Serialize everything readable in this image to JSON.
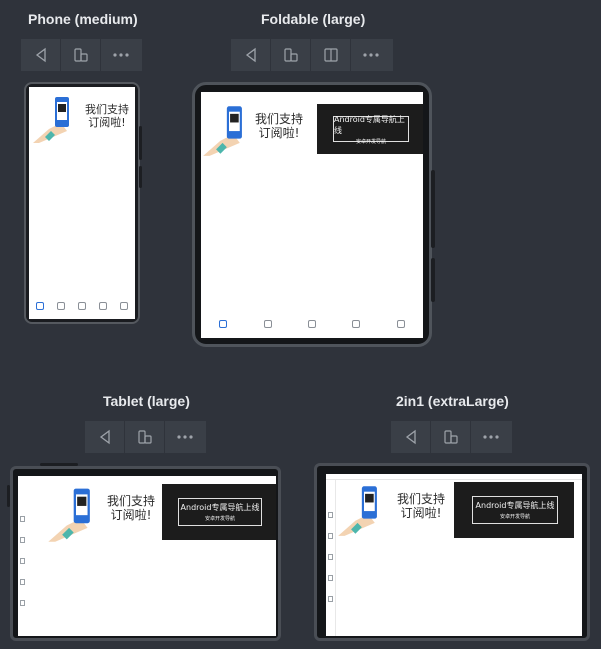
{
  "devices": {
    "phone": {
      "title": "Phone (medium)"
    },
    "foldable": {
      "title": "Foldable (large)"
    },
    "tablet": {
      "title": "Tablet (large)"
    },
    "twoinone": {
      "title": "2in1 (extraLarge)"
    }
  },
  "banner": {
    "line1": "我们支持",
    "line2": "订阅啦!",
    "promo_title": "Android专属导航上线",
    "promo_sub": "安卓开发导航"
  },
  "toolbar_icons": [
    "back-icon",
    "fold-device-icon",
    "split-screen-icon",
    "more-icon"
  ],
  "colors": {
    "background": "#2f333b",
    "accent": "#2b6fd6"
  }
}
